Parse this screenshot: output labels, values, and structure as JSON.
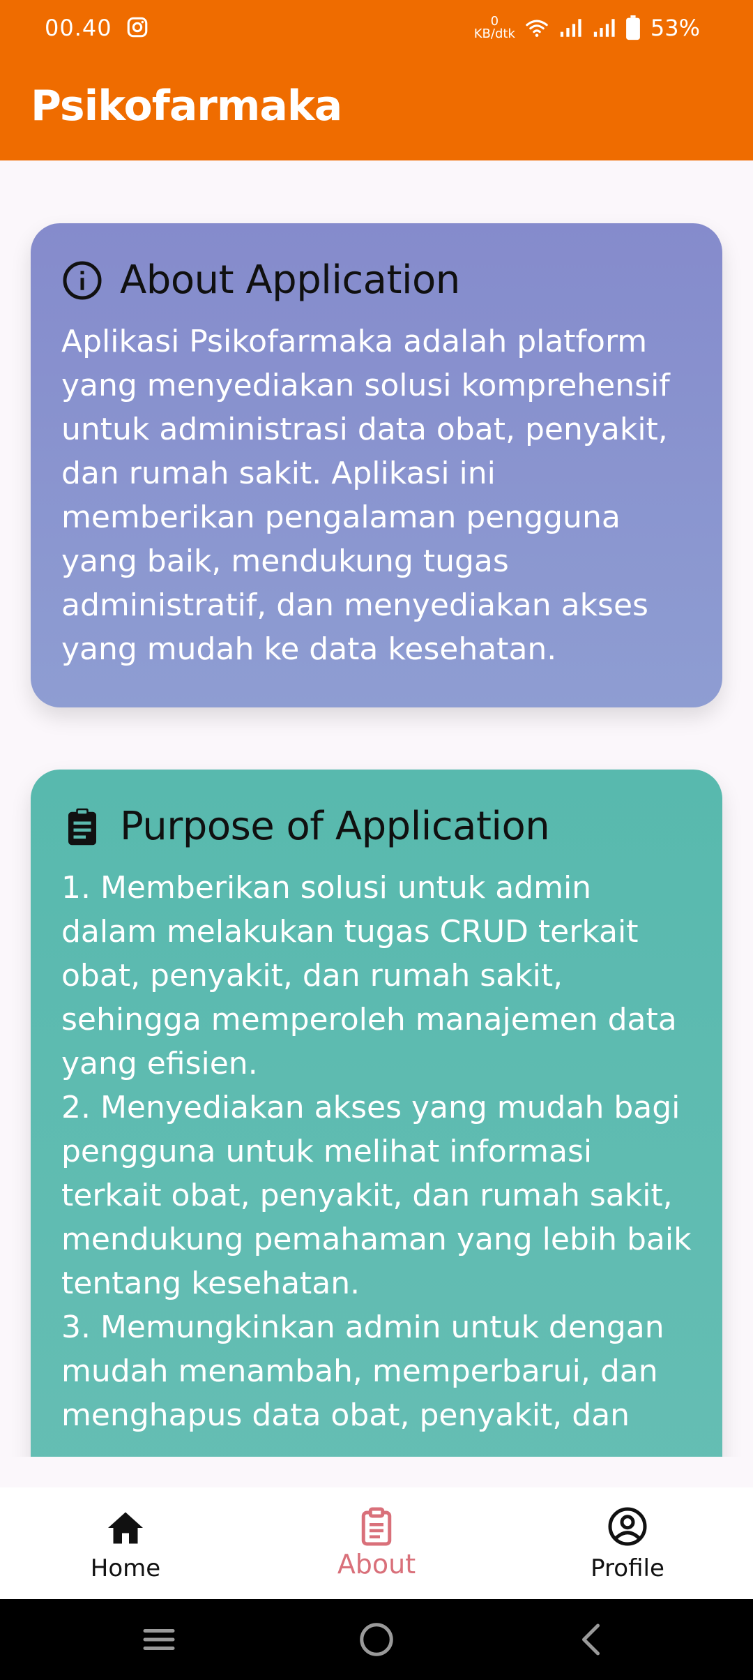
{
  "status_bar": {
    "time": "00.40",
    "net_speed_value": "0",
    "net_speed_unit": "KB/dtk",
    "battery": "53%"
  },
  "app_bar": {
    "title": "Psikofarmaka"
  },
  "cards": {
    "about": {
      "icon": "info-icon",
      "title": "About Application",
      "body": "Aplikasi Psikofarmaka adalah platform yang menyediakan solusi komprehensif untuk administrasi data obat, penyakit, dan rumah sakit. Aplikasi ini memberikan pengalaman pengguna yang baik, mendukung tugas administratif, dan menyediakan akses yang mudah ke data kesehatan.",
      "color": "#858bcc"
    },
    "purpose": {
      "icon": "clipboard-icon",
      "title": "Purpose of Application",
      "body": "1. Memberikan solusi untuk admin dalam melakukan tugas CRUD terkait obat, penyakit, dan rumah sakit, sehingga memperoleh manajemen data yang efisien.\n2. Menyediakan akses yang mudah bagi pengguna untuk melihat informasi terkait obat, penyakit, dan rumah sakit, mendukung pemahaman yang lebih baik tentang kesehatan.\n3. Memungkinkan admin untuk dengan mudah menambah, memperbarui, dan menghapus data obat, penyakit, dan",
      "color": "#58b9ae"
    }
  },
  "bottom_nav": {
    "items": [
      {
        "label": "Home",
        "icon": "home-icon"
      },
      {
        "label": "About",
        "icon": "clipboard-icon"
      },
      {
        "label": "Profile",
        "icon": "account-circle-icon"
      }
    ],
    "active": "About",
    "active_color": "#d9707a"
  },
  "theme": {
    "primary": "#ef6c00",
    "background": "#fbf7fb"
  }
}
